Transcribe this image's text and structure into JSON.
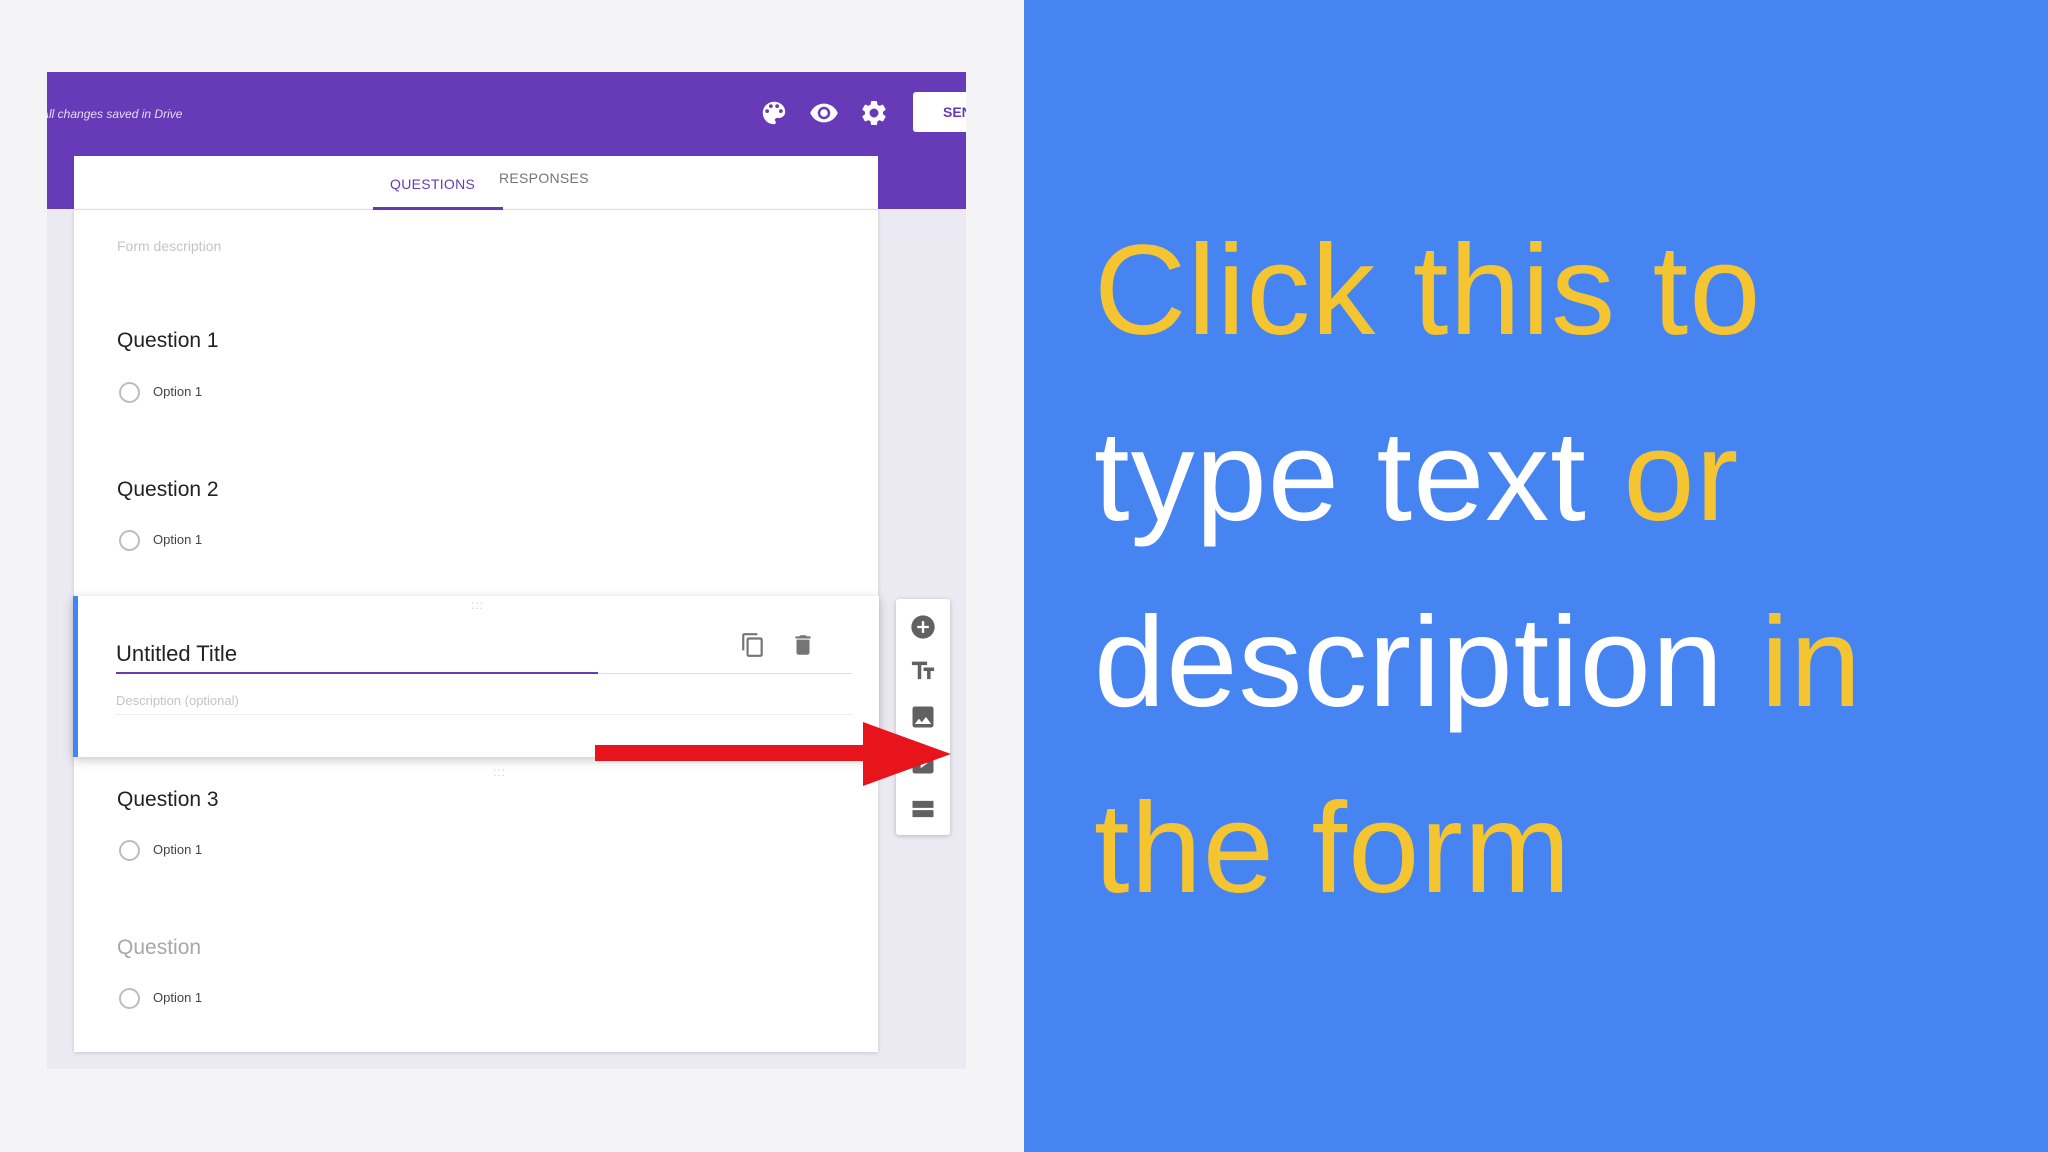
{
  "app": {
    "saved_status": "All changes saved in Drive",
    "send_label": "SEND"
  },
  "tabs": [
    {
      "label": "QUESTIONS",
      "active": true
    },
    {
      "label": "RESPONSES",
      "active": false
    }
  ],
  "form": {
    "description_placeholder": "Form description",
    "questions": [
      {
        "title": "Question 1",
        "option": "Option 1"
      },
      {
        "title": "Question 2",
        "option": "Option 1"
      },
      {
        "title": "Question 3",
        "option": "Option 1"
      },
      {
        "title": "Question",
        "option": "Option 1"
      }
    ],
    "title_block": {
      "title": "Untitled Title",
      "description_placeholder": "Description (optional)"
    }
  },
  "side_toolbar": {
    "items": [
      {
        "icon": "add-question-icon"
      },
      {
        "icon": "add-title-description-icon"
      },
      {
        "icon": "add-image-icon"
      },
      {
        "icon": "add-video-icon"
      },
      {
        "icon": "add-section-icon"
      }
    ]
  },
  "caption": {
    "segments": [
      {
        "text": "Click this to",
        "color": "#f4c431"
      },
      {
        "text": "type text",
        "color": "#ffffff"
      },
      {
        "text": "or",
        "color": "#f4c431"
      },
      {
        "text": "description",
        "color": "#ffffff"
      },
      {
        "text": "in",
        "color": "#f4c431"
      },
      {
        "text": "the form",
        "color": "#f4c431"
      }
    ]
  },
  "colors": {
    "header_purple": "#673ab7",
    "caption_background": "#4684f2",
    "caption_yellow": "#f4c431",
    "arrow_red": "#e8141c",
    "active_card_border": "#4285f4"
  }
}
